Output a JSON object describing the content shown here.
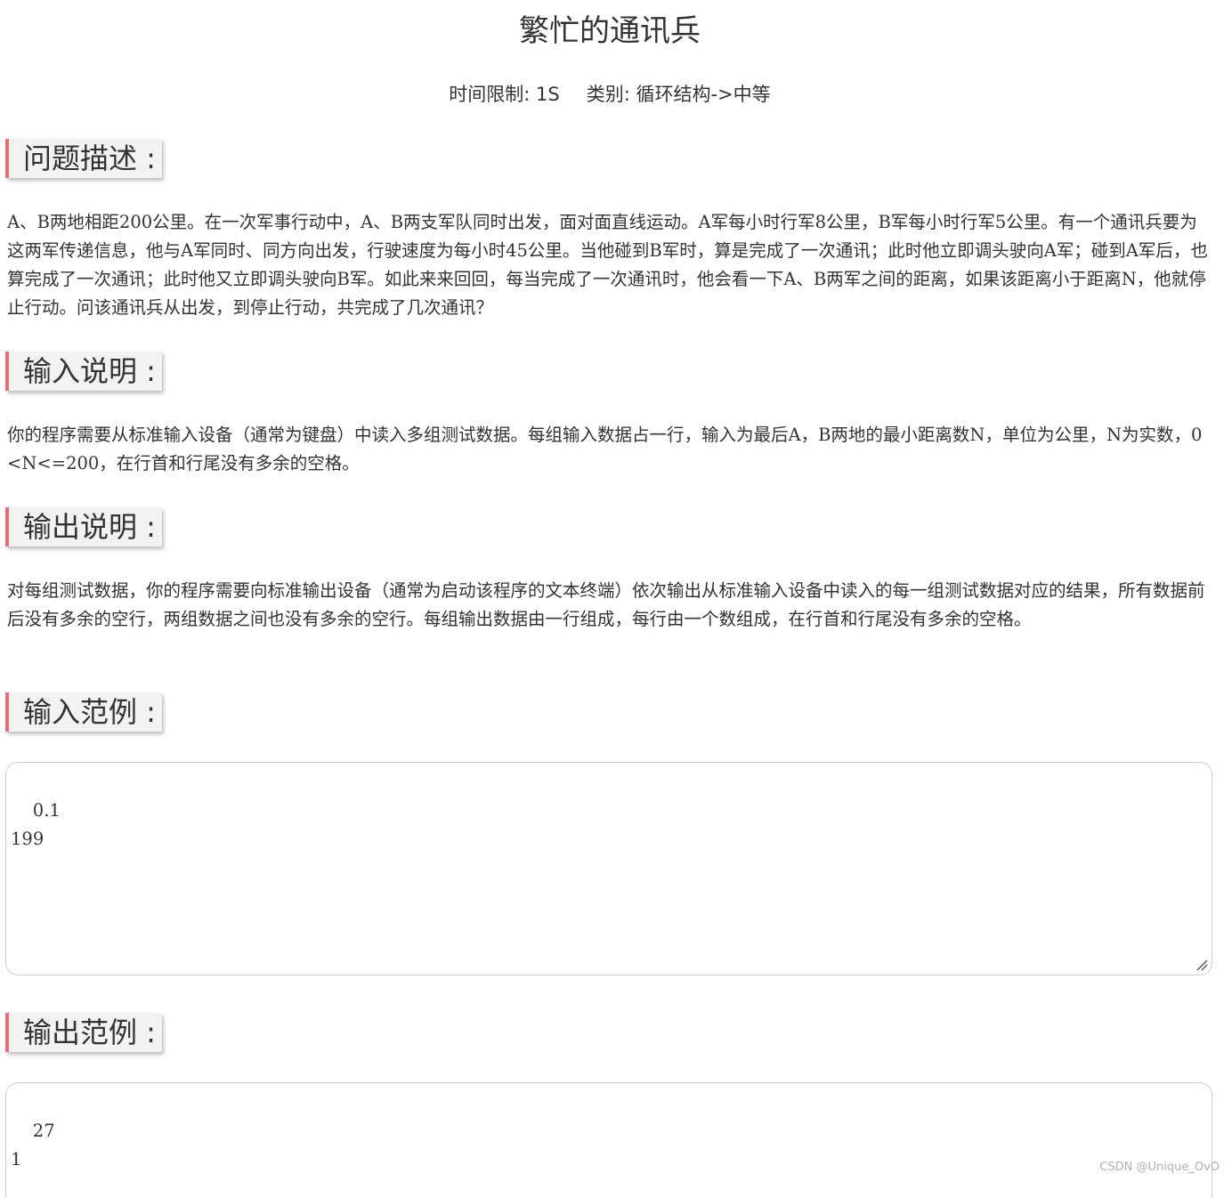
{
  "title": "繁忙的通讯兵",
  "meta": {
    "time_limit": "时间限制: 1S",
    "category": "类别: 循环结构->中等"
  },
  "sections": {
    "problem": {
      "heading": "问题描述 :",
      "text": "A、B两地相距200公里。在一次军事行动中，A、B两支军队同时出发，面对面直线运动。A军每小时行军8公里，B军每小时行军5公里。有一个通讯兵要为这两军传递信息，他与A军同时、同方向出发，行驶速度为每小时45公里。当他碰到B军时，算是完成了一次通讯；此时他立即调头驶向A军；碰到A军后，也算完成了一次通讯；此时他又立即调头驶向B军。如此来来回回，每当完成了一次通讯时，他会看一下A、B两军之间的距离，如果该距离小于距离N，他就停止行动。问该通讯兵从出发，到停止行动，共完成了几次通讯？"
    },
    "input": {
      "heading": "输入说明 :",
      "text": "你的程序需要从标准输入设备（通常为键盘）中读入多组测试数据。每组输入数据占一行，输入为最后A，B两地的最小距离数N，单位为公里，N为实数，0<N<=200，在行首和行尾没有多余的空格。"
    },
    "output": {
      "heading": "输出说明 :",
      "text": "对每组测试数据，你的程序需要向标准输出设备（通常为启动该程序的文本终端）依次输出从标准输入设备中读入的每一组测试数据对应的结果，所有数据前后没有多余的空行，两组数据之间也没有多余的空行。每组输出数据由一行组成，每行由一个数组成，在行首和行尾没有多余的空格。"
    },
    "sample_input": {
      "heading": "输入范例 :",
      "value": "0.1\n199"
    },
    "sample_output": {
      "heading": "输出范例 :",
      "value": "27\n1"
    }
  },
  "watermark": "CSDN @Unique_OvO",
  "colors": {
    "heading_accent": "#e0707a",
    "heading_bg": "#f2f2f2",
    "text": "#333333",
    "border": "#cccccc"
  }
}
